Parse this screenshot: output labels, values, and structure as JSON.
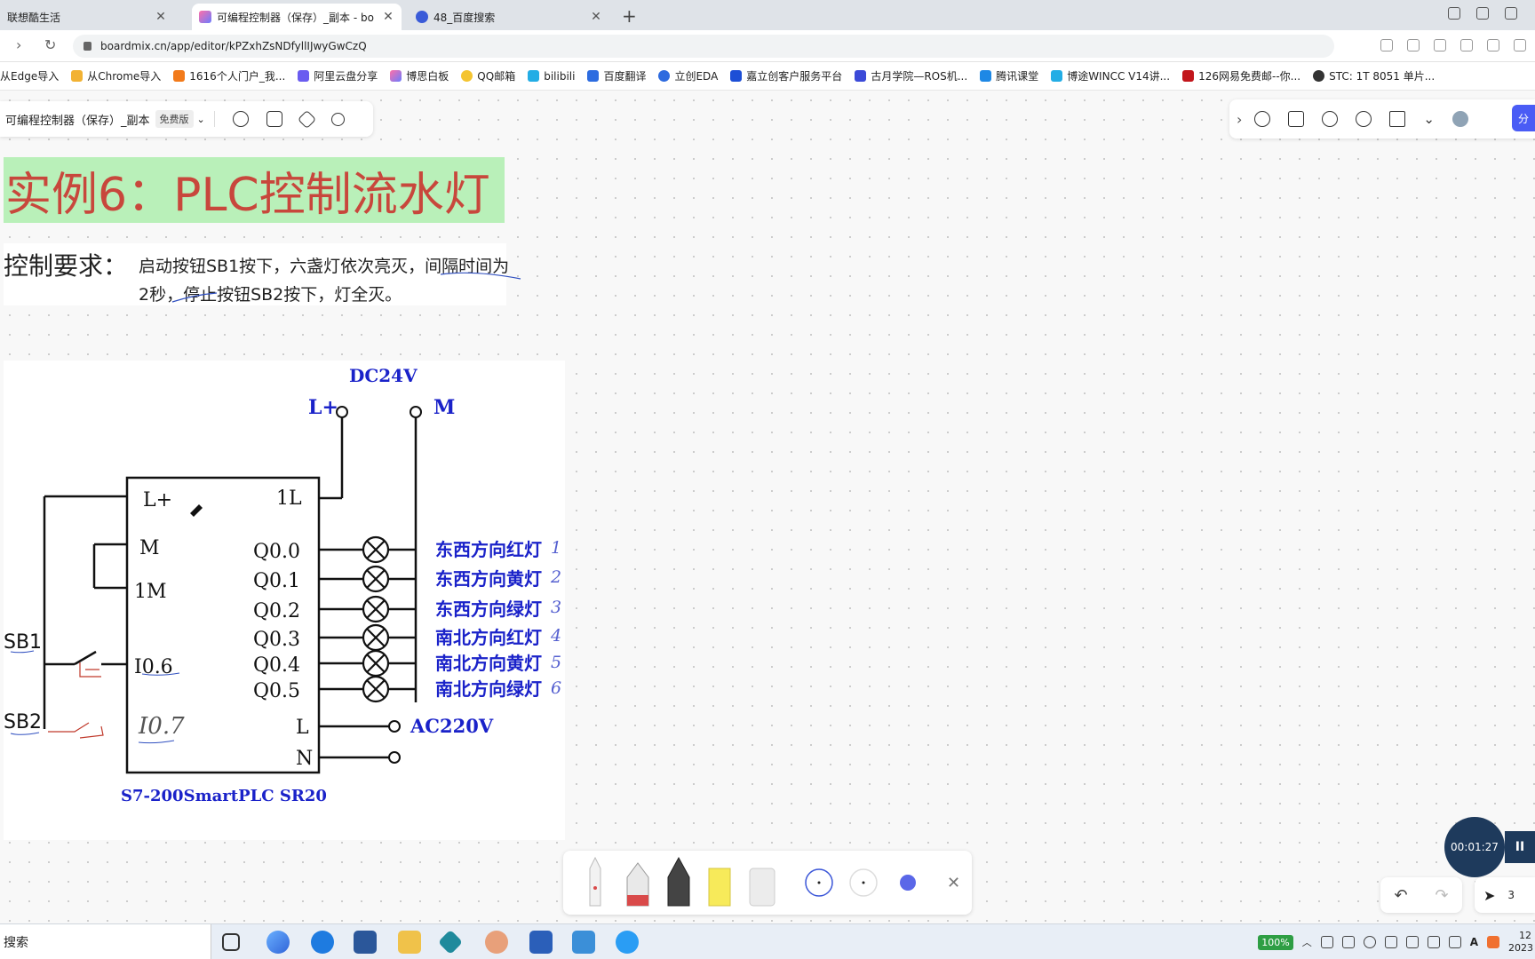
{
  "browser": {
    "tabs": [
      {
        "title": "联想酷生活",
        "active": false
      },
      {
        "title": "可编程控制器（保存）_副本 - bo",
        "active": true
      },
      {
        "title": "48_百度搜索",
        "active": false
      }
    ],
    "url": "boardmix.cn/app/editor/kPZxhZsNDfyllIJwyGwCzQ",
    "bookmarks": [
      "从Edge导入",
      "从Chrome导入",
      "1616个人门户_我...",
      "阿里云盘分享",
      "博思白板",
      "QQ邮箱",
      "bilibili",
      "百度翻译",
      "立创EDA",
      "嘉立创客户服务平台",
      "古月学院—ROS机...",
      "腾讯课堂",
      "博途WINCC V14讲...",
      "126网易免费邮--你...",
      "STC: 1T 8051 单片..."
    ]
  },
  "editor": {
    "doc_title": "可编程控制器（保存）_副本",
    "plan_badge": "免费版",
    "share_label": "分"
  },
  "canvas": {
    "title": "实例6：PLC控制流水灯",
    "req_label": "控制要求：",
    "req_text": "启动按钮SB1按下，六盏灯依次亮灭，间隔时间为2秒，停止按钮SB2按下，灯全灭。"
  },
  "diagram": {
    "supply_label": "DC24V",
    "lplus_top": "L+",
    "m_top": "M",
    "plc_model": "S7-200SmartPLC SR20",
    "left_terminals": [
      "L+",
      "M",
      "1M",
      "I0.6"
    ],
    "right_terminals": [
      "1L",
      "Q0.0",
      "Q0.1",
      "Q0.2",
      "Q0.3",
      "Q0.4",
      "Q0.5",
      "L",
      "N"
    ],
    "lamps": [
      "东西方向红灯",
      "东西方向黄灯",
      "东西方向绿灯",
      "南北方向红灯",
      "南北方向黄灯",
      "南北方向绿灯"
    ],
    "lamp_numbers": [
      "1",
      "2",
      "3",
      "4",
      "5",
      "6"
    ],
    "ac_label": "AC220V",
    "sb1": "SB1",
    "sb2": "SB2",
    "handwritten_input": "I0.7"
  },
  "recorder": {
    "time": "00:01:27"
  },
  "taskbar": {
    "search": "搜索",
    "battery": "100%",
    "clock_time": "12",
    "clock_date": "2023"
  },
  "colors": {
    "title_red": "#c8473c",
    "title_bg": "#b9f0b9",
    "diagram_blue": "#1a22c9",
    "brand_blue": "#4a5cf5",
    "timer_bg": "#1e3a5c"
  },
  "zoom_hint": "3"
}
